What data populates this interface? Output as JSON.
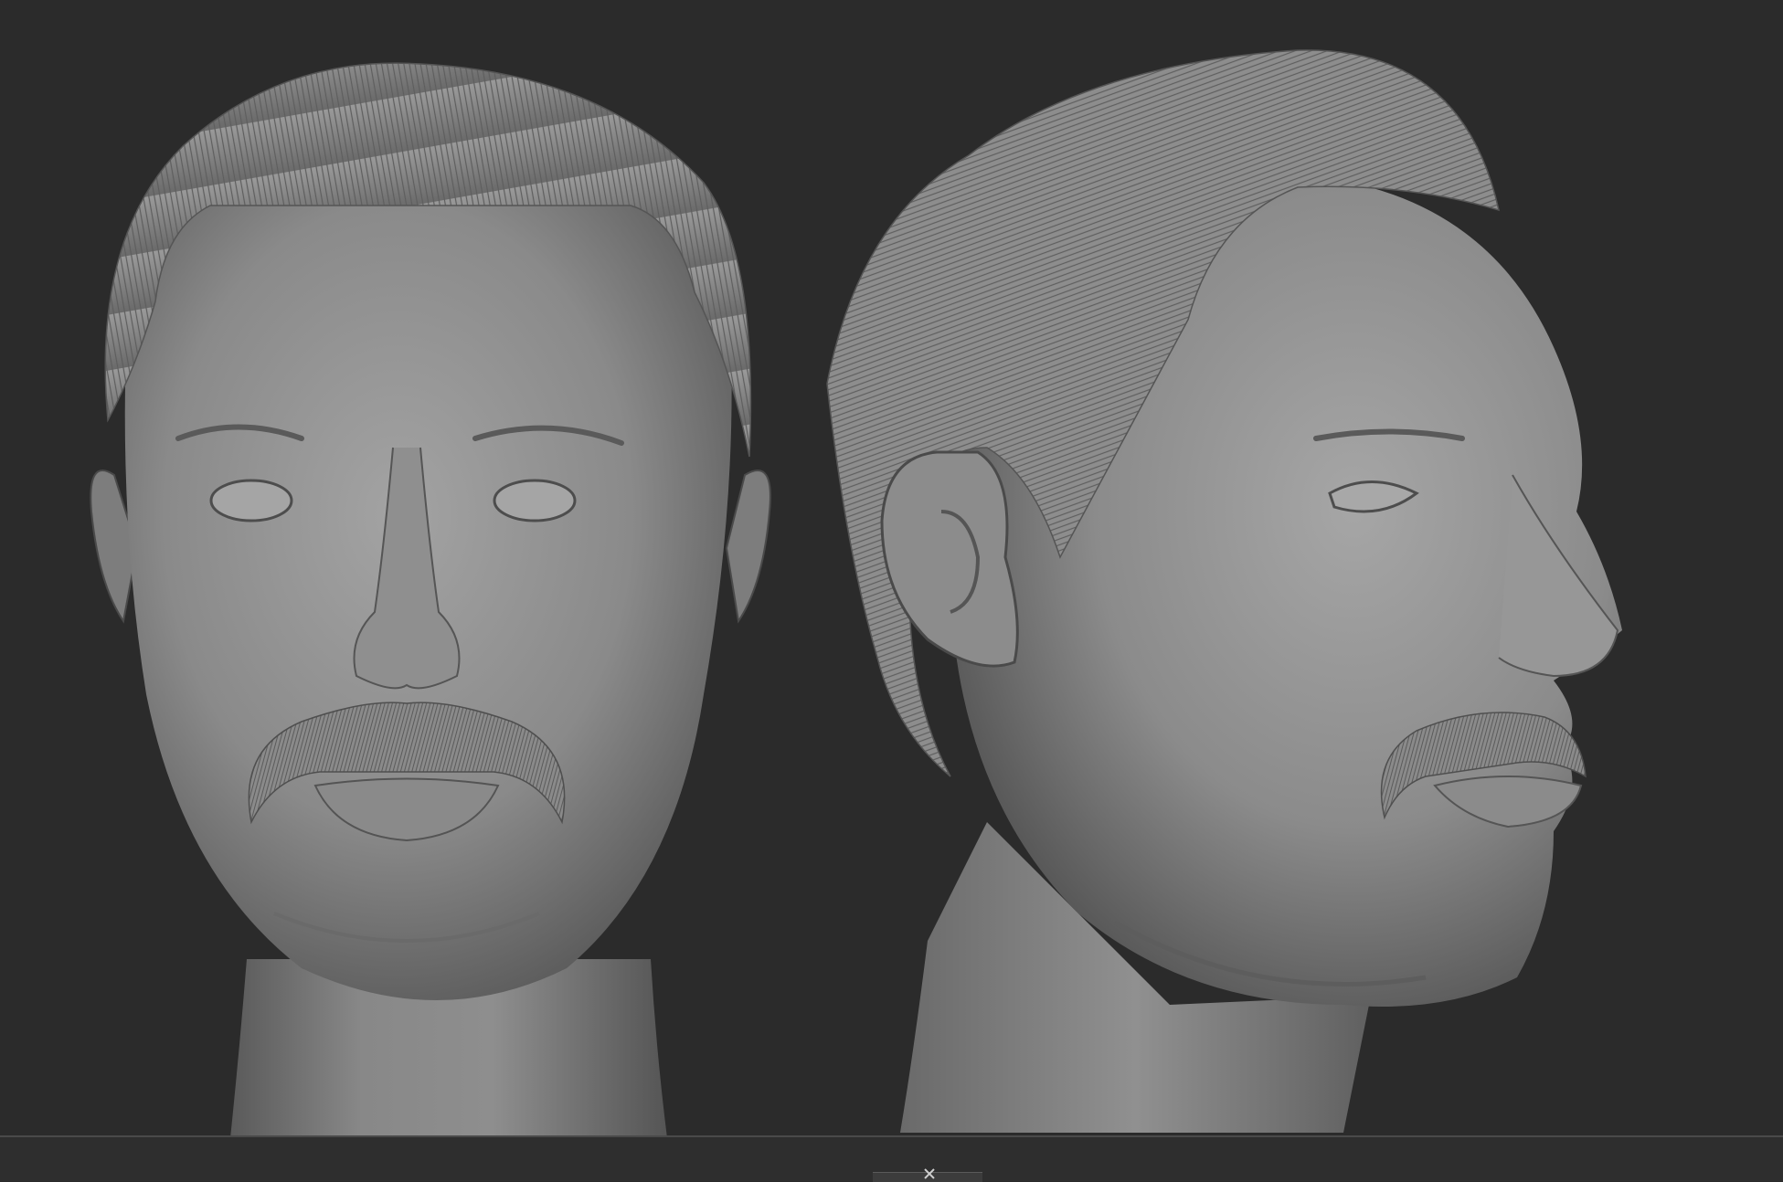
{
  "viewport": {
    "background_color": "#2b2b2b",
    "material_color": "#8c8c8c"
  },
  "models": [
    {
      "view": "front"
    },
    {
      "view": "three-quarter-right"
    }
  ],
  "icons": [
    "navigation-gizmo-icon"
  ]
}
